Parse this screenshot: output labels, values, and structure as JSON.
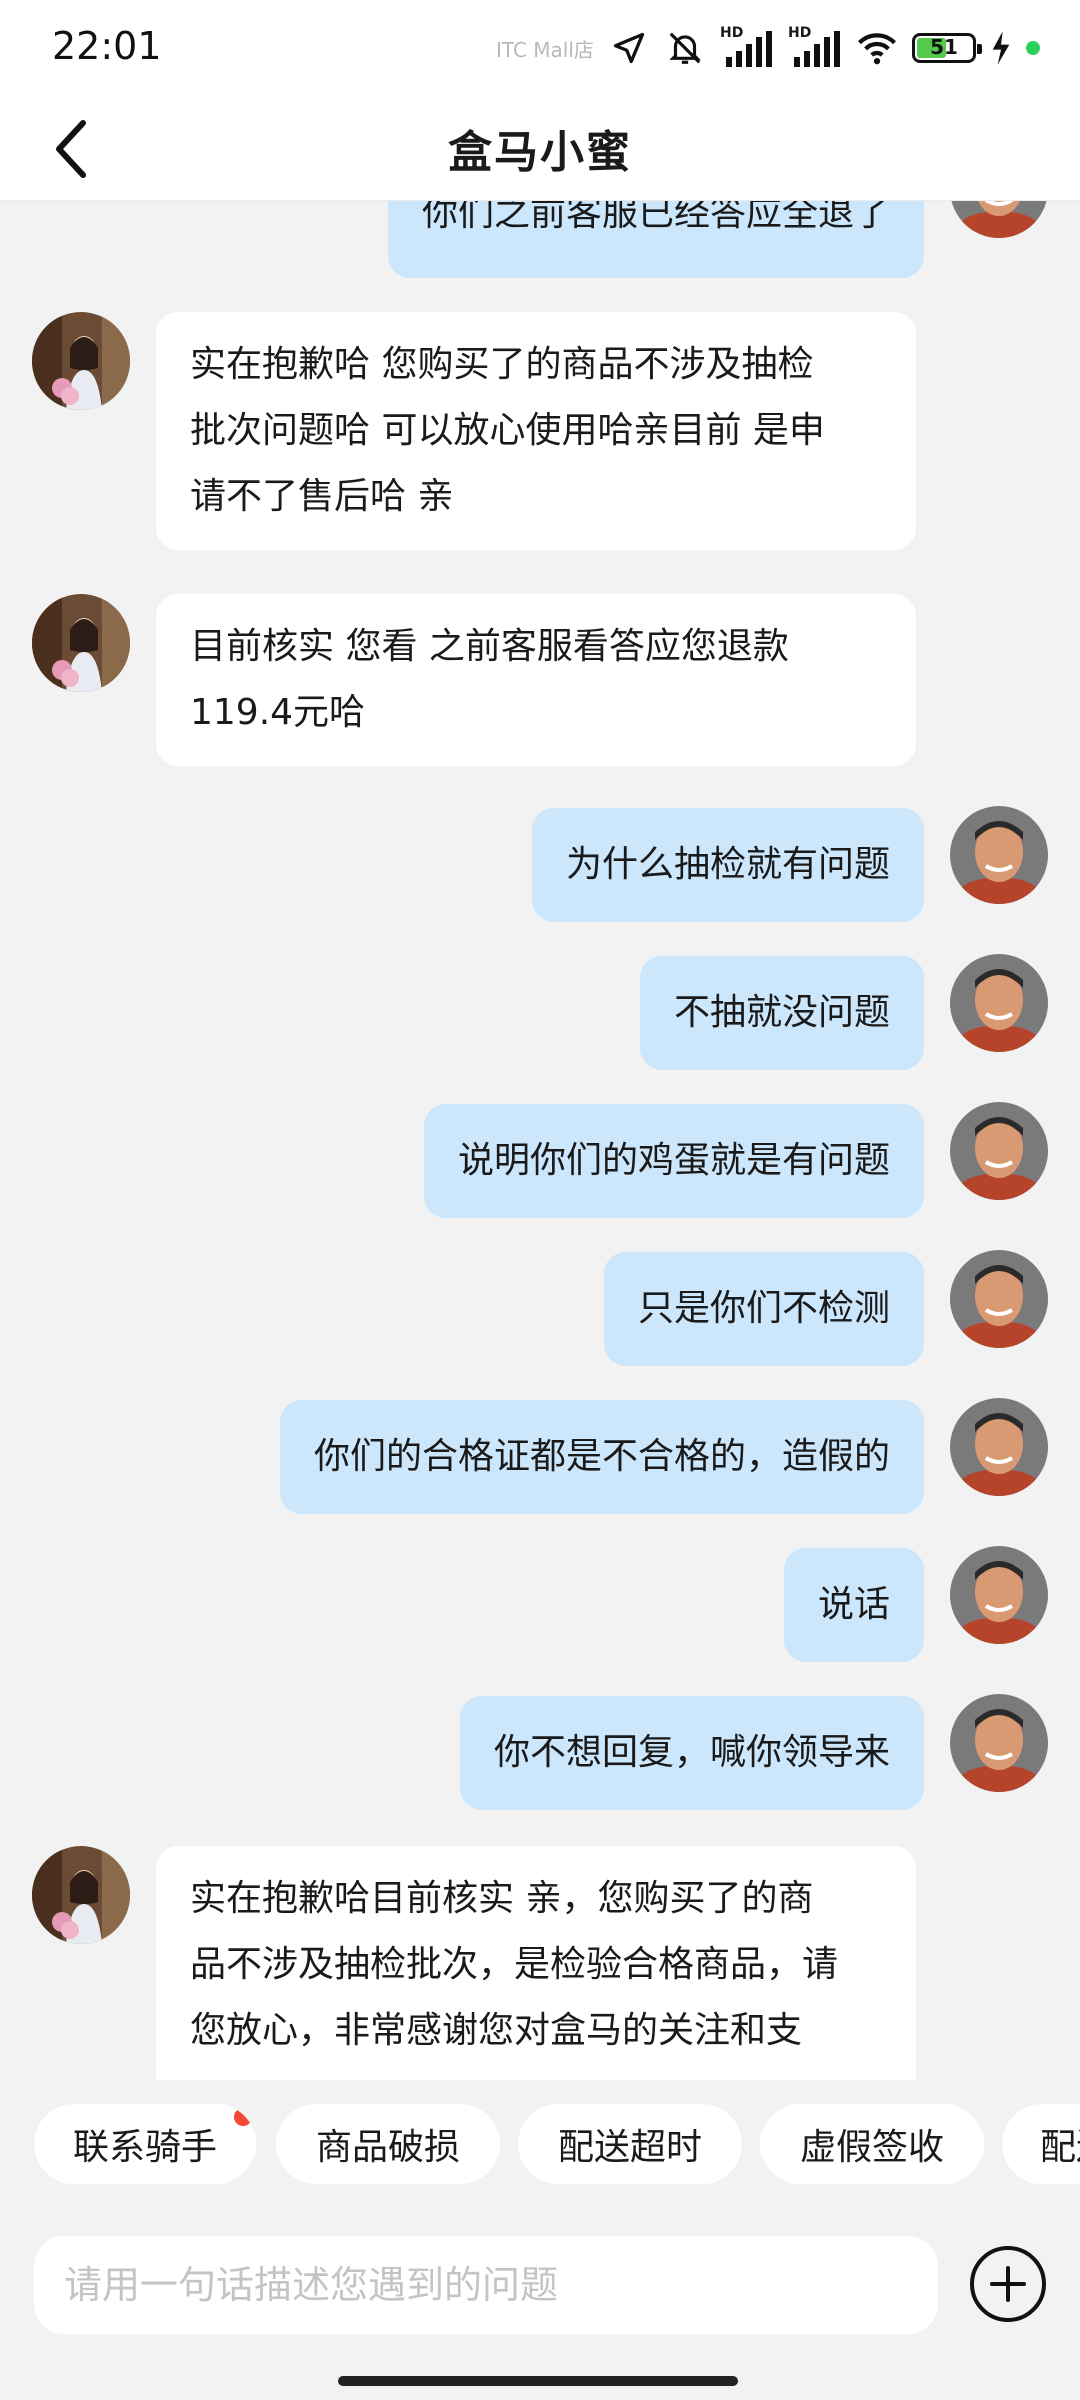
{
  "status_bar": {
    "time": "22:01",
    "carrier": "ITC Mall店",
    "battery_level": "51",
    "icons": [
      "location-arrow-icon",
      "bell-muted-icon",
      "hd-signal-icon",
      "hd-signal-icon",
      "wifi-icon",
      "battery-icon",
      "charging-icon",
      "green-dot-icon"
    ]
  },
  "header": {
    "title": "盒马小蜜"
  },
  "messages": [
    {
      "from": "me",
      "text": "你们之前客服已经答应全退了"
    },
    {
      "from": "agent",
      "lines": [
        " 实在抱歉哈  您购买了的商品不涉及抽检",
        "批次问题哈  可以放心使用哈亲目前 是申",
        "请不了售后哈 亲"
      ]
    },
    {
      "from": "agent",
      "lines": [
        "目前核实 您看 之前客服看答应您退款",
        "119.4元哈"
      ]
    },
    {
      "from": "me",
      "text": "为什么抽检就有问题"
    },
    {
      "from": "me",
      "text": "不抽就没问题"
    },
    {
      "from": "me",
      "text": "说明你们的鸡蛋就是有问题"
    },
    {
      "from": "me",
      "text": "只是你们不检测"
    },
    {
      "from": "me",
      "text": "你们的合格证都是不合格的，造假的"
    },
    {
      "from": "me",
      "text": "说话"
    },
    {
      "from": "me",
      "text": "你不想回复，喊你领导来"
    },
    {
      "from": "agent",
      "lines": [
        " 实在抱歉哈目前核实 亲，您购买了的商",
        "品不涉及抽检批次，是检验合格商品，请",
        "您放心，非常感谢您对盒马的关注和支"
      ]
    }
  ],
  "quick_replies": [
    "联系骑手",
    "商品破损",
    "配送超时",
    "虚假签收",
    "配送"
  ],
  "input": {
    "placeholder": "请用一句话描述您遇到的问题",
    "value": ""
  },
  "colors": {
    "my_bubble": "#cce6fb",
    "agent_bubble": "#ffffff",
    "background": "#f2f2f2",
    "badge": "#f24a37"
  }
}
